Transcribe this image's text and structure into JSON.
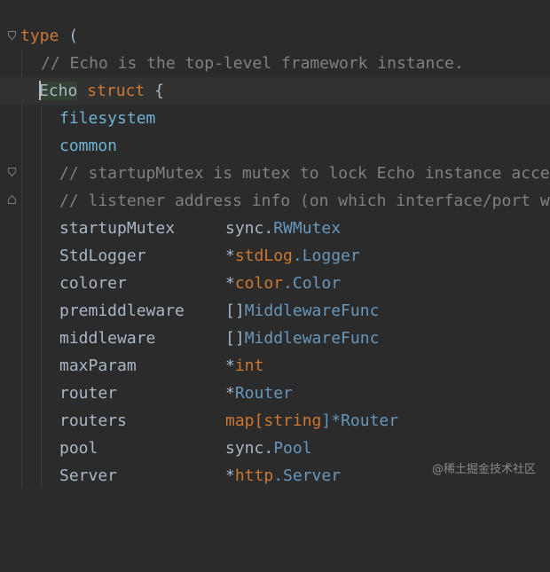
{
  "code": {
    "line1": {
      "kw": "type",
      "rest": " ("
    },
    "line2": {
      "comment": "// Echo is the top-level framework instance."
    },
    "line3": {
      "name": "Echo",
      "kw": "struct",
      "rest": " {"
    },
    "line4": {
      "field": "filesystem"
    },
    "line5": {
      "field": "common"
    },
    "line6": {
      "comment": "// startupMutex is mutex to lock Echo instance acce"
    },
    "line7": {
      "comment": "// listener address info (on which interface/port w"
    },
    "fields": [
      {
        "name": "startupMutex",
        "t1": "sync",
        "t2": ".",
        "t3": "RWMutex"
      },
      {
        "name": "StdLogger",
        "t1": "*",
        "t2": "stdLog",
        "t3": ".Logger"
      },
      {
        "name": "colorer",
        "t1": "*",
        "t2": "color",
        "t3": ".Color"
      },
      {
        "name": "premiddleware",
        "t1": "[]",
        "t2": "",
        "t3": "MiddlewareFunc"
      },
      {
        "name": "middleware",
        "t1": "[]",
        "t2": "",
        "t3": "MiddlewareFunc"
      },
      {
        "name": "maxParam",
        "t1": "*",
        "t2": "int",
        "t3": ""
      },
      {
        "name": "router",
        "t1": "*",
        "t2": "",
        "t3": "Router"
      },
      {
        "name": "routers",
        "t1": "map[",
        "t2": "string",
        "t3": "]*Router"
      },
      {
        "name": "pool",
        "t1": "sync",
        "t2": ".",
        "t3": "Pool"
      },
      {
        "name": "Server",
        "t1": "*",
        "t2": "http",
        "t3": ".Server"
      }
    ]
  },
  "watermark": "@稀土掘金技术社区",
  "colors": {
    "background": "#2b2b2b",
    "keyword": "#cc7832",
    "comment": "#808080",
    "field": "#9876aa",
    "type": "#6897bb",
    "text": "#a9b7c6"
  }
}
